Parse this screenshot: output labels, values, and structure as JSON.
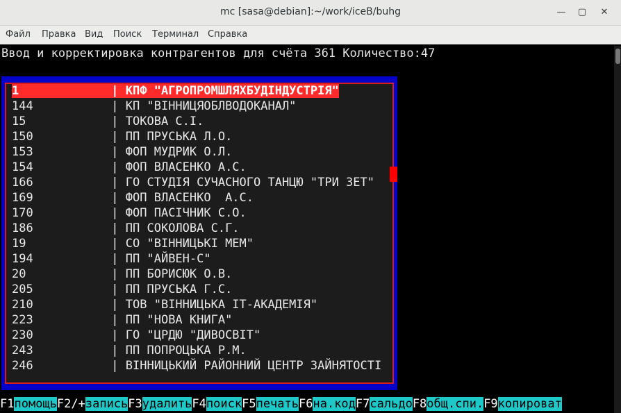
{
  "window": {
    "title": "mc [sasa@debian]:~/work/iceB/buhg",
    "minimize": "—",
    "maximize": "▢",
    "close": "✕"
  },
  "menu": [
    "Файл",
    "Правка",
    "Вид",
    "Поиск",
    "Терминал",
    "Справка"
  ],
  "header": "Ввод и корректировка контрагентов для счёта 361 Количество:47",
  "rows": [
    {
      "code": "1",
      "name": "КПФ \"АГРОПРОМШЛЯХБУДІНДУСТРІЯ\""
    },
    {
      "code": "144",
      "name": "КП \"ВІННИЦЯОБЛВОДОКАНАЛ\""
    },
    {
      "code": "15",
      "name": "ТОКОВА С.І."
    },
    {
      "code": "150",
      "name": "ПП ПРУСЬКА Л.О."
    },
    {
      "code": "153",
      "name": "ФОП МУДРИК О.Л."
    },
    {
      "code": "154",
      "name": "ФОП ВЛАСЕНКО А.С."
    },
    {
      "code": "166",
      "name": "ГО СТУДІЯ СУЧАСНОГО ТАНЦЮ \"ТРИ ЗЕТ\""
    },
    {
      "code": "169",
      "name": "ФОП ВЛАСЕНКО  А.С."
    },
    {
      "code": "170",
      "name": "ФОП ПАСІЧНИК С.О."
    },
    {
      "code": "186",
      "name": "ПП СОКОЛОВА С.Г."
    },
    {
      "code": "19",
      "name": "СО \"ВІННИЦЬКІ МЕМ\""
    },
    {
      "code": "194",
      "name": "ПП \"АЙВЕН-С\""
    },
    {
      "code": "20",
      "name": "ПП БОРИСЮК О.В."
    },
    {
      "code": "205",
      "name": "ПП ПРУСЬКА Г.С."
    },
    {
      "code": "210",
      "name": "ТОВ \"ВІННИЦЬКА ІТ-АКАДЕМІЯ\""
    },
    {
      "code": "223",
      "name": "ПП \"НОВА КНИГА\""
    },
    {
      "code": "230",
      "name": "ГО \"ЦРДЮ \"ДИВОСВІТ\""
    },
    {
      "code": "243",
      "name": "ПП ПОПРОЦЬКА Р.М."
    },
    {
      "code": "246",
      "name": "ВІННИЦЬКИЙ РАЙОННИЙ ЦЕНТР ЗАЙНЯТОСТІ"
    }
  ],
  "selected_index": 0,
  "fkeys": [
    {
      "key": "F1",
      "label": "помощь"
    },
    {
      "key": "F2/+",
      "label": "запись"
    },
    {
      "key": "F3",
      "label": "удалить"
    },
    {
      "key": "F4",
      "label": "поиск"
    },
    {
      "key": "F5",
      "label": "печать"
    },
    {
      "key": "F6",
      "label": "на.код"
    },
    {
      "key": "F7",
      "label": "сальдо"
    },
    {
      "key": "F8",
      "label": "общ.спи."
    },
    {
      "key": "F9",
      "label": "копироват"
    }
  ],
  "colors": {
    "box_border": "#0000c8",
    "frame": "#d81b1b",
    "selection": "#ff2a2a",
    "fkey_label_bg": "#1ec8c8"
  }
}
